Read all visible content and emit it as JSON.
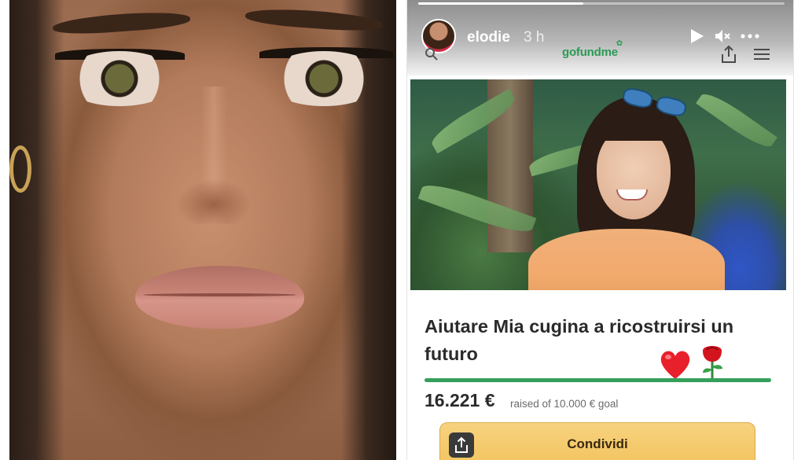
{
  "story": {
    "username": "elodie",
    "time": "3 h",
    "progress": 0.45,
    "brand": "gofundme",
    "icons": {
      "play": "play-icon",
      "mute": "mute-icon",
      "more": "more-icon",
      "share": "share-icon",
      "menu": "menu-icon",
      "search": "search-icon"
    }
  },
  "campaign": {
    "title": "Aiutare Mia cugina a ricostruirsi un futuro",
    "amount": "16.221 €",
    "raised_note": "raised of 10.000 € goal",
    "progress": 1.0,
    "share_label": "Condividi",
    "emojis": [
      "❤️",
      "🌹"
    ]
  },
  "colors": {
    "brand_green": "#2c9a55",
    "progress_green": "#35a05a",
    "button_yellow": "#f3c45f"
  }
}
